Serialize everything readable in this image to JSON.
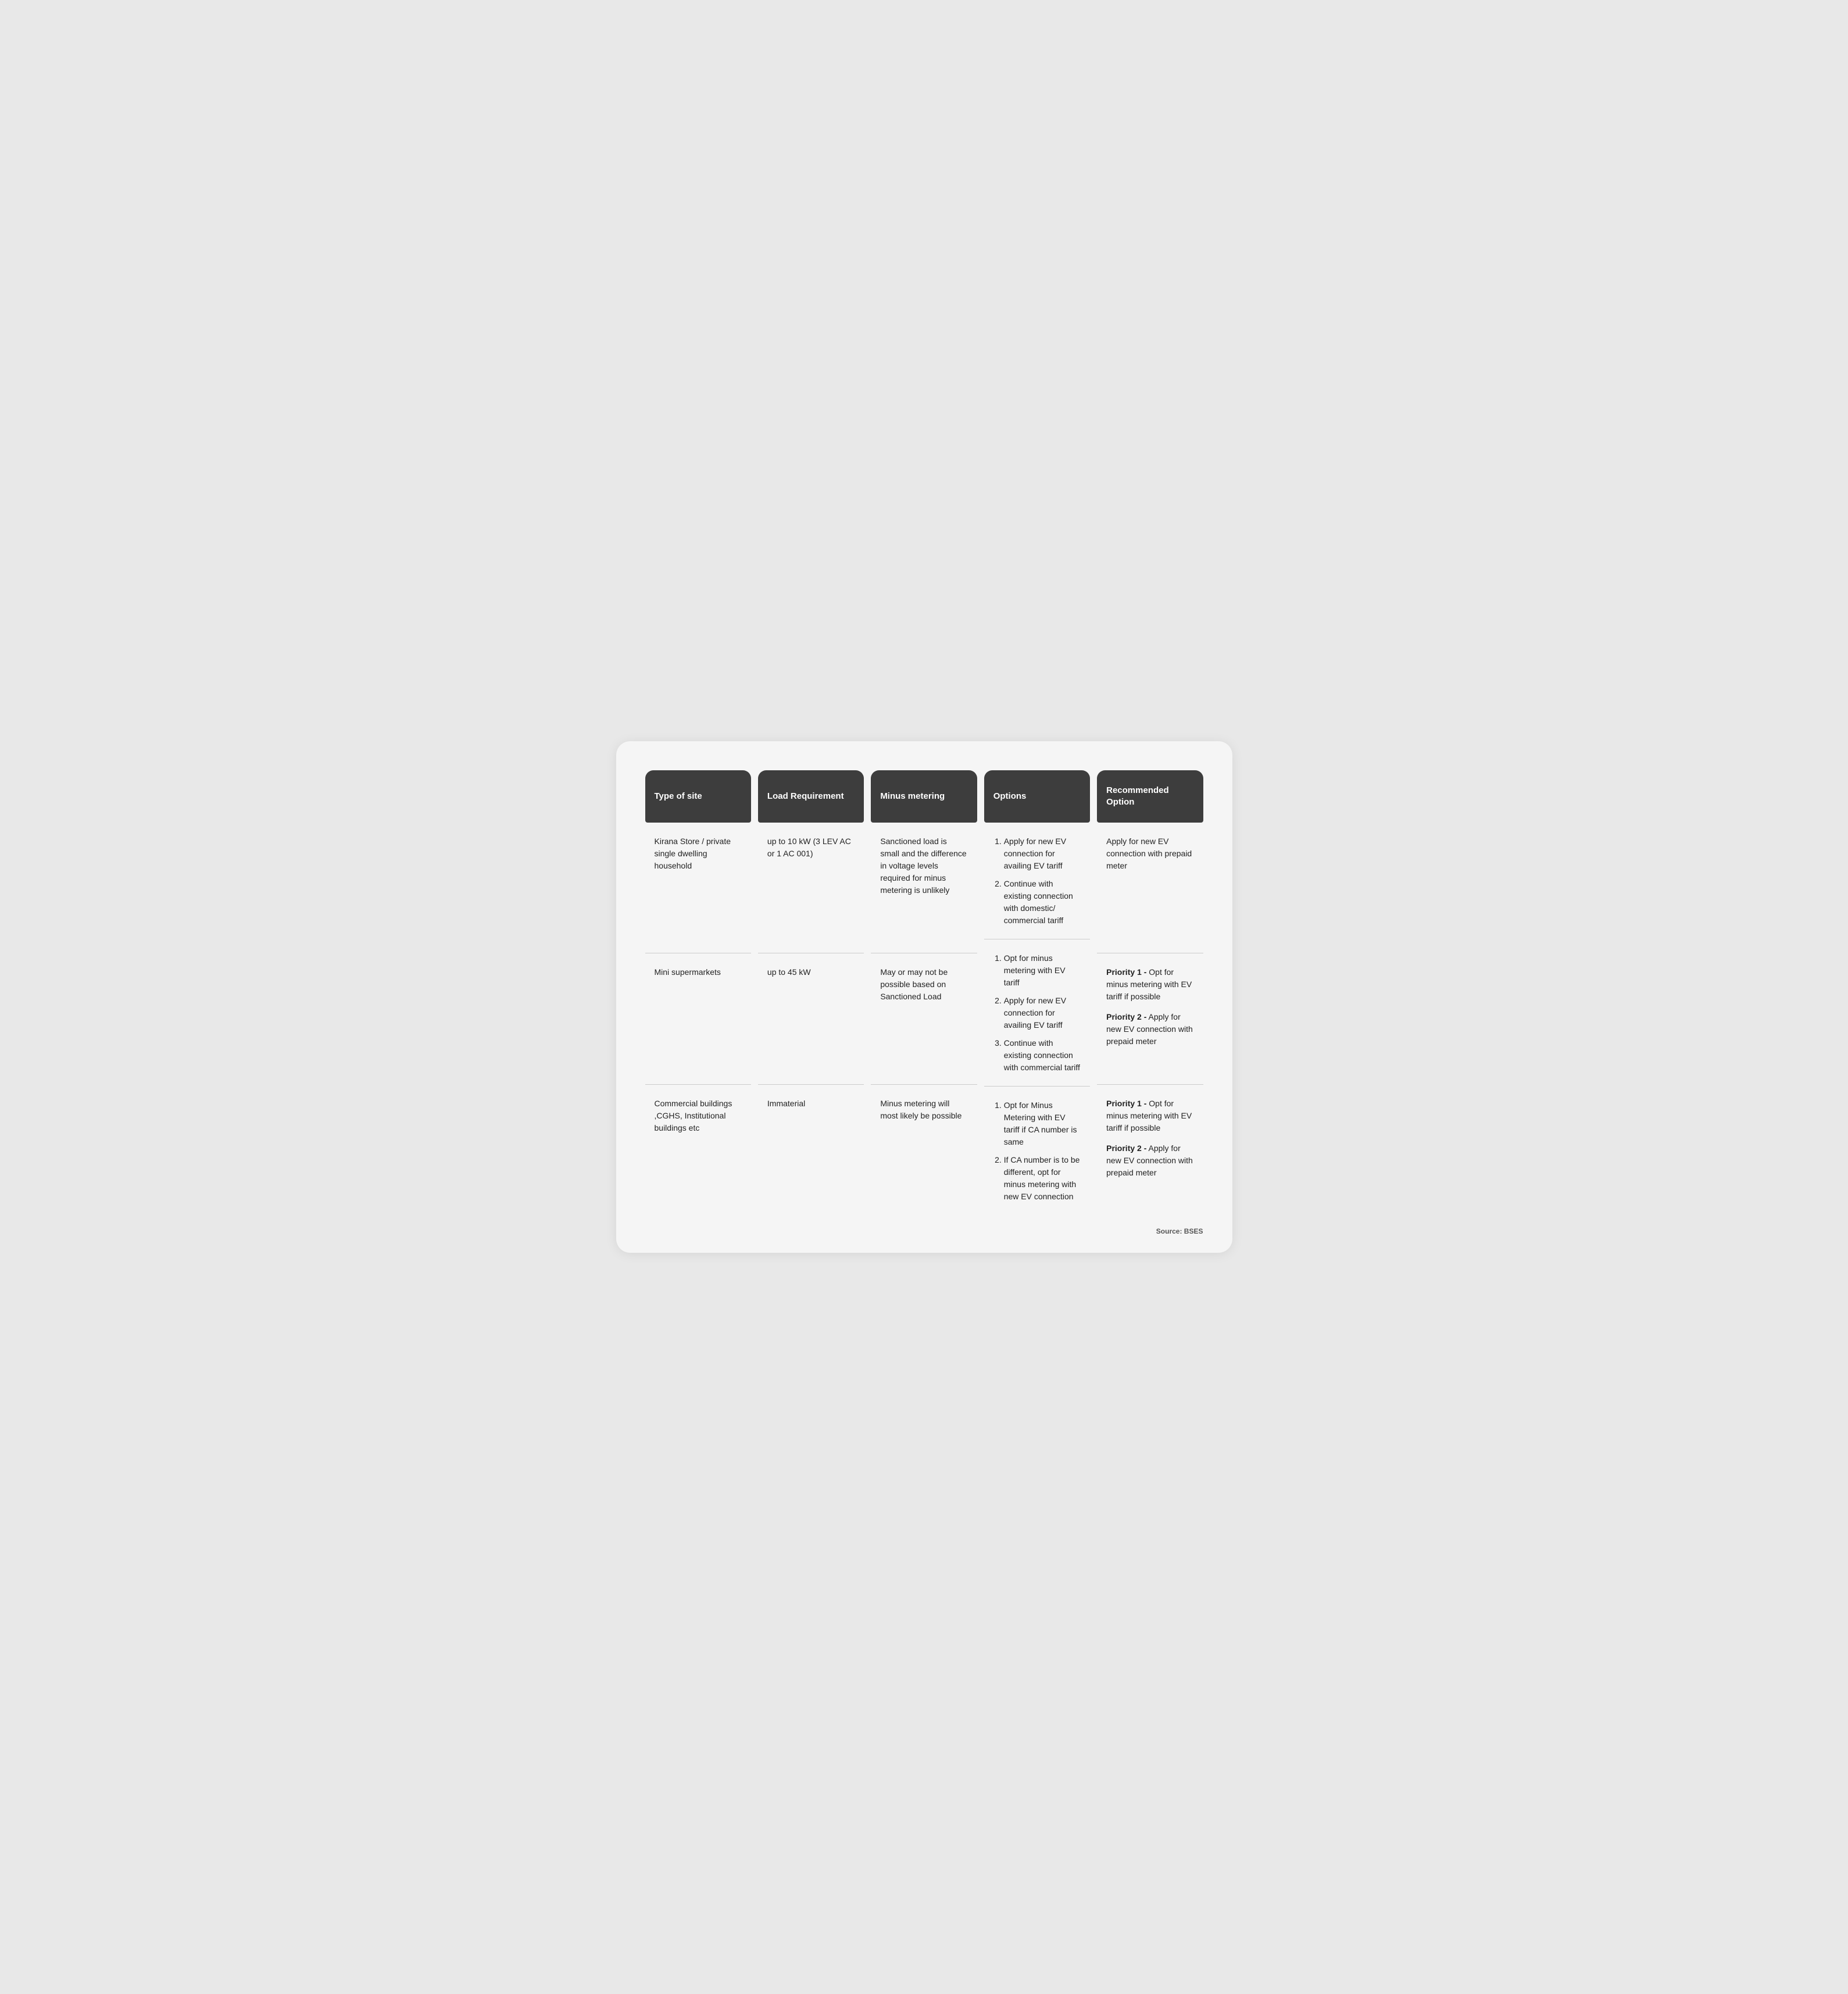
{
  "headers": [
    {
      "id": "type-of-site",
      "label": "Type of site"
    },
    {
      "id": "load-requirement",
      "label": "Load Requirement"
    },
    {
      "id": "minus-metering",
      "label": "Minus metering"
    },
    {
      "id": "options",
      "label": "Options"
    },
    {
      "id": "recommended-option",
      "label": "Recommended Option"
    }
  ],
  "rows": [
    {
      "site_type": "Kirana Store / private single dwelling household",
      "load_requirement": "up to 10 kW (3 LEV AC or 1 AC 001)",
      "minus_metering": "Sanctioned load is small and the difference in voltage levels required for minus metering is unlikely",
      "options_html": "<ol><li>Apply for new EV connection for availing EV tariff</li><li>Continue with existing connection with domestic/ commercial tariff</li></ol>",
      "recommended_html": "Apply for new EV connection with prepaid meter"
    },
    {
      "site_type": "Mini supermarkets",
      "load_requirement": "up to 45 kW",
      "minus_metering": "May or may not be possible based on Sanctioned Load",
      "options_html": "<ol><li>Opt for minus metering with EV tariff</li><li>Apply for new EV connection for availing EV tariff</li><li>Continue with existing connection with commercial tariff</li></ol>",
      "recommended_html": "<div class='priority-block'><strong>Priority 1 -</strong> Opt for minus metering with EV tariff if possible</div><div class='priority-block'><strong>Priority 2 -</strong> Apply for new EV connection with prepaid meter</div>"
    },
    {
      "site_type": "Commercial buildings ,CGHS, Institutional buildings etc",
      "load_requirement": "Immaterial",
      "minus_metering": "Minus metering will most likely be possible",
      "options_html": "<ol><li>Opt for Minus Metering with EV tariff if CA number is same</li><li>If CA number is to be different, opt for minus metering with new EV connection</li></ol>",
      "recommended_html": "<div class='priority-block'><strong>Priority 1 -</strong> Opt for minus metering with EV tariff if possible</div><div class='priority-block'><strong>Priority 2 -</strong> Apply for new EV connection with prepaid meter</div>"
    }
  ],
  "source": "Source: BSES"
}
